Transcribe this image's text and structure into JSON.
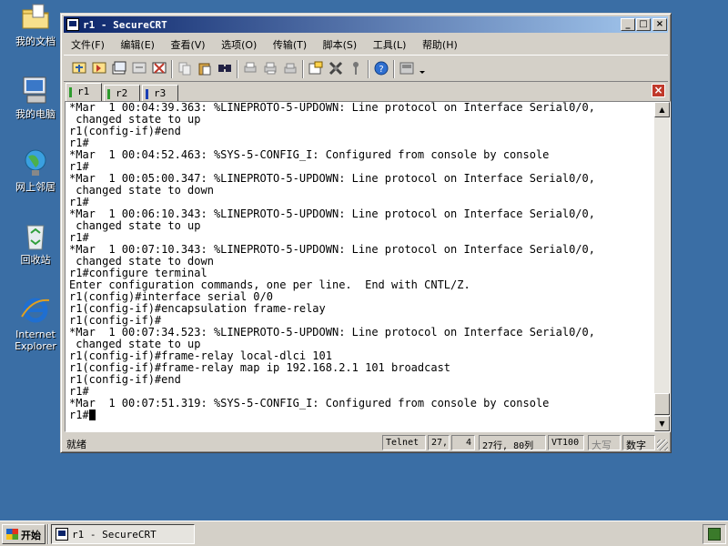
{
  "desktop": {
    "icons": [
      {
        "label": "我的文档",
        "icon": "folder-icon"
      },
      {
        "label": "我的电脑",
        "icon": "computer-icon"
      },
      {
        "label": "网上邻居",
        "icon": "network-icon"
      },
      {
        "label": "回收站",
        "icon": "recycle-bin-icon"
      },
      {
        "label": "Internet Explorer",
        "icon": "ie-icon"
      }
    ]
  },
  "window": {
    "title": "r1 - SecureCRT",
    "controls": {
      "minimize": "_",
      "maximize": "□",
      "close": "×"
    }
  },
  "menu": [
    "文件(F)",
    "编辑(E)",
    "查看(V)",
    "选项(O)",
    "传输(T)",
    "脚本(S)",
    "工具(L)",
    "帮助(H)"
  ],
  "toolbar": {
    "icons": [
      "connect-icon",
      "quick-connect-icon",
      "connect-tab-icon",
      "reconnect-icon",
      "disconnect-icon",
      "copy-icon",
      "paste-icon",
      "find-icon",
      "print-icon",
      "print-selection-icon",
      "print-setup-icon",
      "session-options-icon",
      "global-options-icon",
      "keymap-icon",
      "help-icon",
      "sftp-icon"
    ]
  },
  "tabs": [
    {
      "label": "r1",
      "active": true,
      "color": "#2e9b2e"
    },
    {
      "label": "r2",
      "active": false,
      "color": "#2e9b2e"
    },
    {
      "label": "r3",
      "active": false,
      "color": "#1a3fb4"
    }
  ],
  "terminal": {
    "lines": [
      "*Mar  1 00:04:39.363: %LINEPROTO-5-UPDOWN: Line protocol on Interface Serial0/0,",
      " changed state to up",
      "r1(config-if)#end",
      "r1#",
      "*Mar  1 00:04:52.463: %SYS-5-CONFIG_I: Configured from console by console",
      "r1#",
      "*Mar  1 00:05:00.347: %LINEPROTO-5-UPDOWN: Line protocol on Interface Serial0/0,",
      " changed state to down",
      "r1#",
      "*Mar  1 00:06:10.343: %LINEPROTO-5-UPDOWN: Line protocol on Interface Serial0/0,",
      " changed state to up",
      "r1#",
      "*Mar  1 00:07:10.343: %LINEPROTO-5-UPDOWN: Line protocol on Interface Serial0/0,",
      " changed state to down",
      "r1#configure terminal",
      "Enter configuration commands, one per line.  End with CNTL/Z.",
      "r1(config)#interface serial 0/0",
      "r1(config-if)#encapsulation frame-relay",
      "r1(config-if)#",
      "*Mar  1 00:07:34.523: %LINEPROTO-5-UPDOWN: Line protocol on Interface Serial0/0,",
      " changed state to up",
      "r1(config-if)#frame-relay local-dlci 101",
      "r1(config-if)#frame-relay map ip 192.168.2.1 101 broadcast",
      "r1(config-if)#end",
      "r1#",
      "*Mar  1 00:07:51.319: %SYS-5-CONFIG_I: Configured from console by console"
    ],
    "prompt": "r1#"
  },
  "status": {
    "ready": "就绪",
    "protocol": "Telnet",
    "row": "27,",
    "col": "4",
    "rows_cols": "27行, 80列",
    "emulation": "VT100",
    "caps": "大写",
    "num": "数字"
  },
  "taskbar": {
    "start": "开始",
    "task": "r1 - SecureCRT"
  }
}
